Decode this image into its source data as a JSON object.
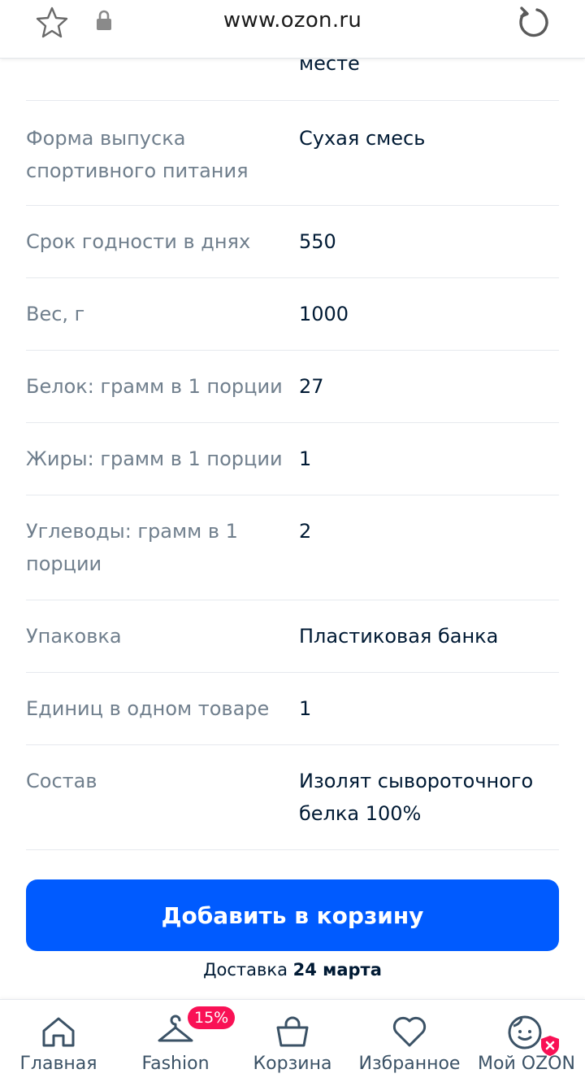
{
  "browser": {
    "url": "www.ozon.ru"
  },
  "specs": {
    "partial_value": "месте",
    "rows": [
      {
        "label": "Форма выпуска спортивного питания",
        "value": "Сухая смесь"
      },
      {
        "label": "Срок годности в днях",
        "value": "550"
      },
      {
        "label": "Вес, г",
        "value": "1000"
      },
      {
        "label": "Белок: грамм в 1 порции",
        "value": "27"
      },
      {
        "label": "Жиры: грамм в 1 порции",
        "value": "1"
      },
      {
        "label": "Углеводы: грамм в 1 порции",
        "value": "2"
      },
      {
        "label": "Упаковка",
        "value": "Пластиковая банка"
      },
      {
        "label": "Единиц в одном товаре",
        "value": "1"
      },
      {
        "label": "Состав",
        "value": "Изолят сывороточного белка 100%"
      }
    ]
  },
  "cart": {
    "button_label": "Добавить в корзину",
    "delivery_prefix": "Доставка",
    "delivery_date": "24 марта"
  },
  "nav": {
    "home": "Главная",
    "fashion": "Fashion",
    "fashion_badge": "15%",
    "cart": "Корзина",
    "favorites": "Избранное",
    "my_ozon": "Мой OZON"
  },
  "colors": {
    "accent": "#005bff",
    "badge": "#f91155",
    "label": "#707f8d",
    "text": "#001a34"
  }
}
